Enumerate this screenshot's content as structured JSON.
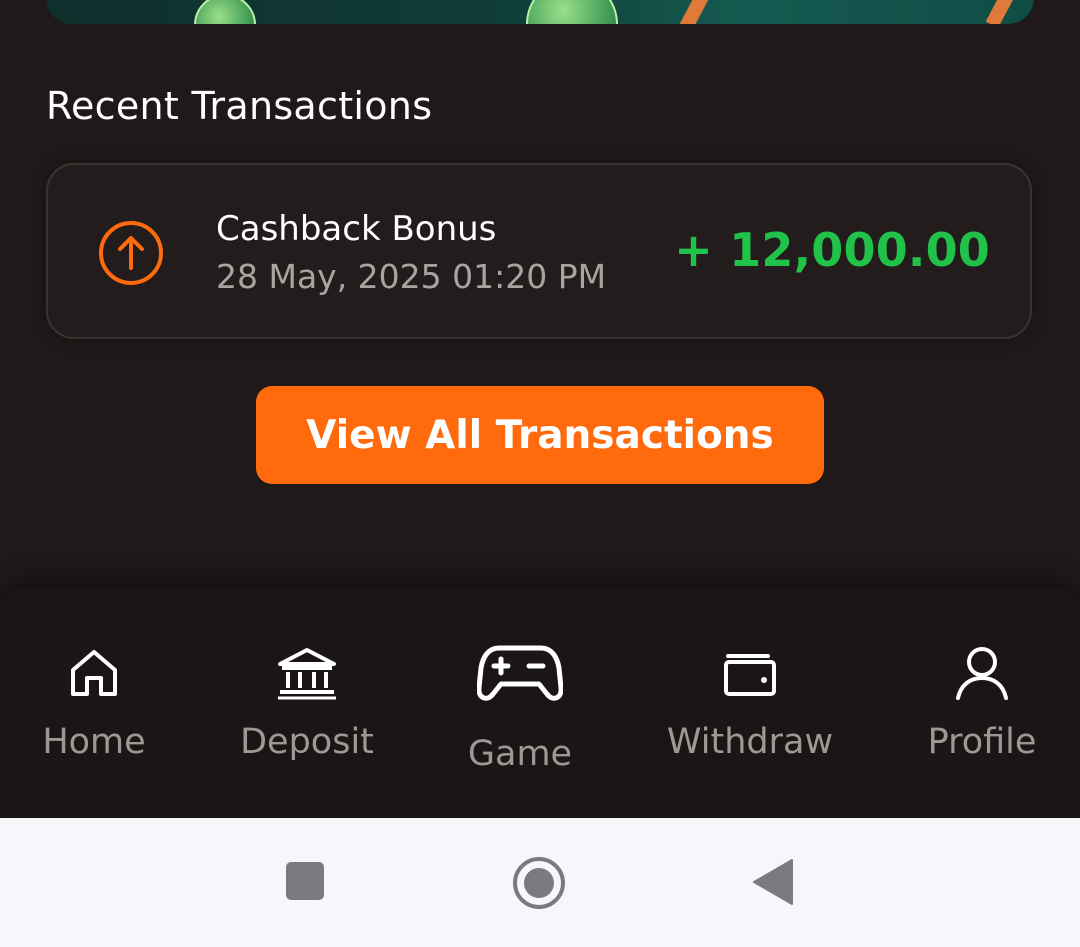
{
  "section": {
    "title": "Recent Transactions"
  },
  "transactions": [
    {
      "icon": "arrow-up-circle-icon",
      "title": "Cashback Bonus",
      "date": "28 May, 2025 01:20 PM",
      "amount": "+ 12,000.00",
      "amount_color": "#21c24a"
    }
  ],
  "view_all_label": "View All Transactions",
  "nav": {
    "items": [
      {
        "label": "Home",
        "icon": "home-icon"
      },
      {
        "label": "Deposit",
        "icon": "bank-icon"
      },
      {
        "label": "Game",
        "icon": "gamepad-icon",
        "active": true
      },
      {
        "label": "Withdraw",
        "icon": "wallet-icon"
      },
      {
        "label": "Profile",
        "icon": "user-icon"
      }
    ]
  },
  "system_nav": {
    "buttons": [
      "recents-square-icon",
      "home-circle-icon",
      "back-triangle-icon"
    ]
  },
  "colors": {
    "background": "#1f1a19",
    "accent": "#ff6a0d",
    "positive": "#21c24a",
    "muted_text": "#9d9896"
  }
}
